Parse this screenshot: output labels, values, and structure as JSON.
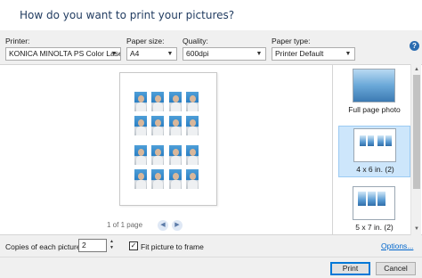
{
  "window": {
    "title": "How do you want to print your pictures?"
  },
  "options": {
    "printer": {
      "label": "Printer:",
      "value": "KONICA MINOLTA PS Color Laser"
    },
    "paper_size": {
      "label": "Paper size:",
      "value": "A4"
    },
    "quality": {
      "label": "Quality:",
      "value": "600dpi"
    },
    "paper_type": {
      "label": "Paper type:",
      "value": "Printer Default"
    },
    "help": "?"
  },
  "preview": {
    "pager_text": "1 of 1 page",
    "prev_icon": "◀",
    "next_icon": "▶"
  },
  "layouts": [
    {
      "label": "Full page photo",
      "selected": false
    },
    {
      "label": "4 x 6 in. (2)",
      "selected": true
    },
    {
      "label": "5 x 7 in. (2)",
      "selected": false
    }
  ],
  "scrollbar": {
    "up": "▲",
    "down": "▼"
  },
  "bottom": {
    "copies_label": "Copies of each picture:",
    "copies_value": "2",
    "spin_up": "▲",
    "spin_down": "▼",
    "fit_checked": true,
    "fit_check_mark": "✓",
    "fit_label": "Fit picture to frame",
    "options_link": "Options..."
  },
  "buttons": {
    "print": "Print",
    "cancel": "Cancel"
  }
}
